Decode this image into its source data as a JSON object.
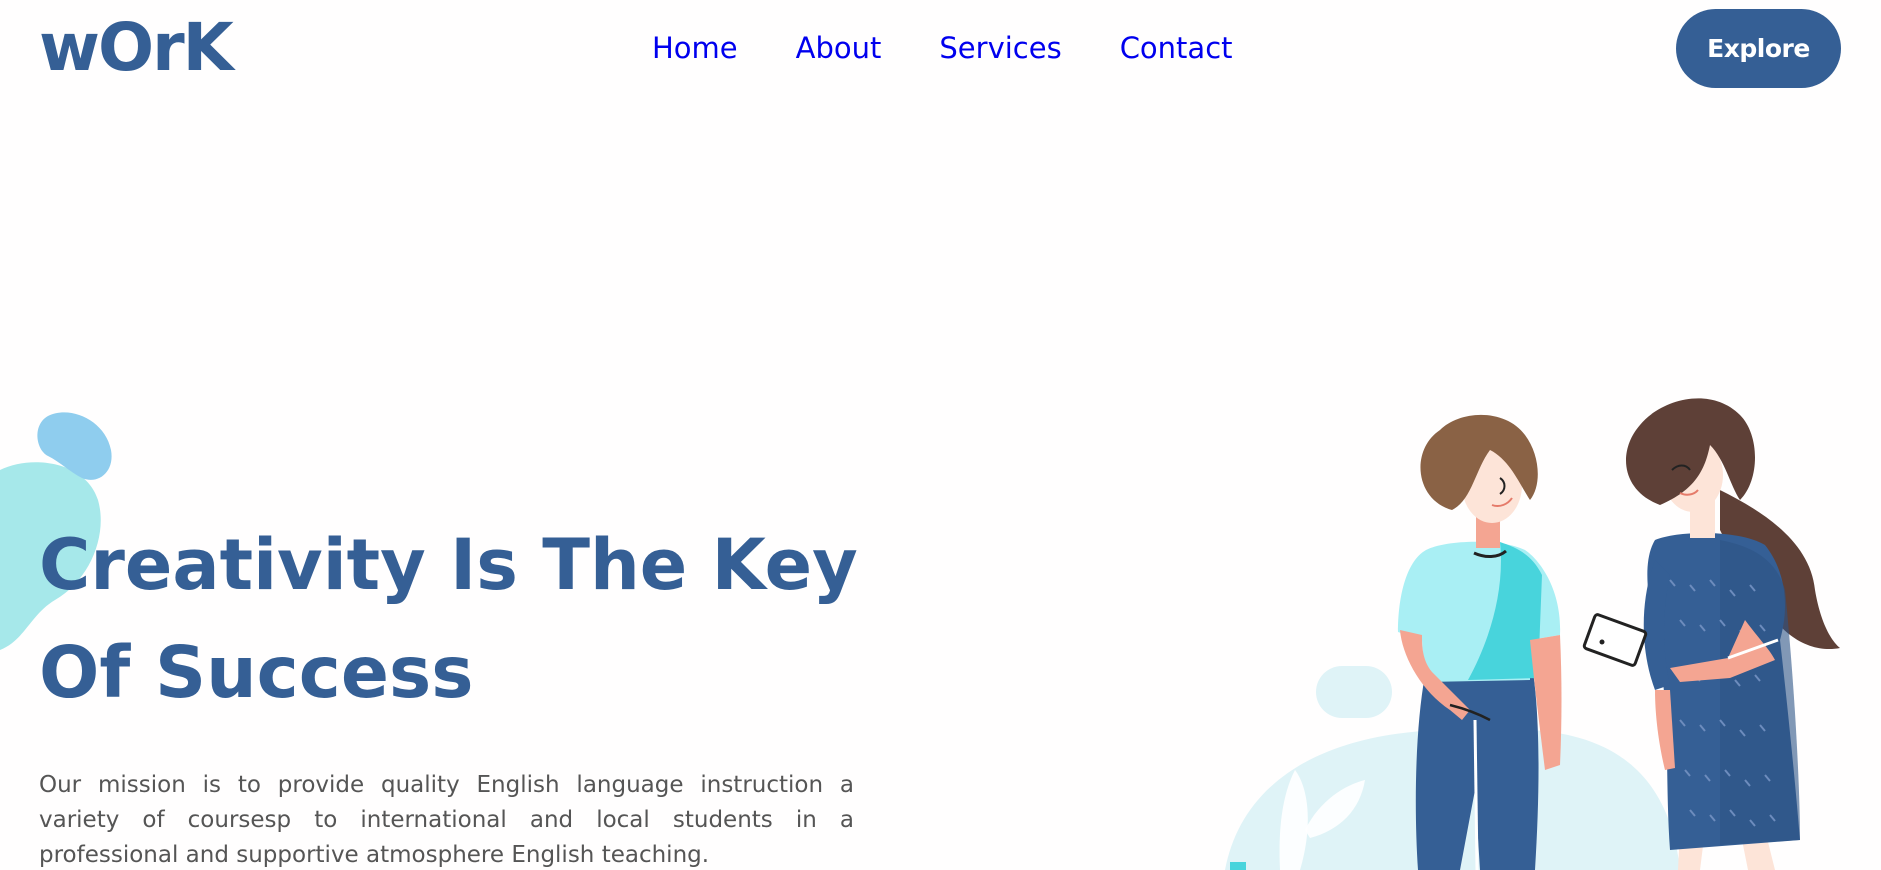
{
  "header": {
    "logo": "wOrK",
    "nav": [
      "Home",
      "About",
      "Services",
      "Contact"
    ],
    "cta_label": "Explore"
  },
  "hero": {
    "title_line1": "Creativity Is The Key",
    "title_line2": "Of Success",
    "description": "Our mission is to provide quality English language instruction a variety of coursesp to international and local students in a professional and supportive atmosphere English teaching."
  },
  "colors": {
    "brand": "#355f95",
    "nav_link": "#0000ee",
    "blob_light": "#a6e8ea",
    "blob_blue": "#8fcdee",
    "shirt": "#48d4dc",
    "hair_light": "#8a6245",
    "hair_dark": "#5e4037"
  },
  "illustration": {
    "subject": "two-women-illustration"
  }
}
